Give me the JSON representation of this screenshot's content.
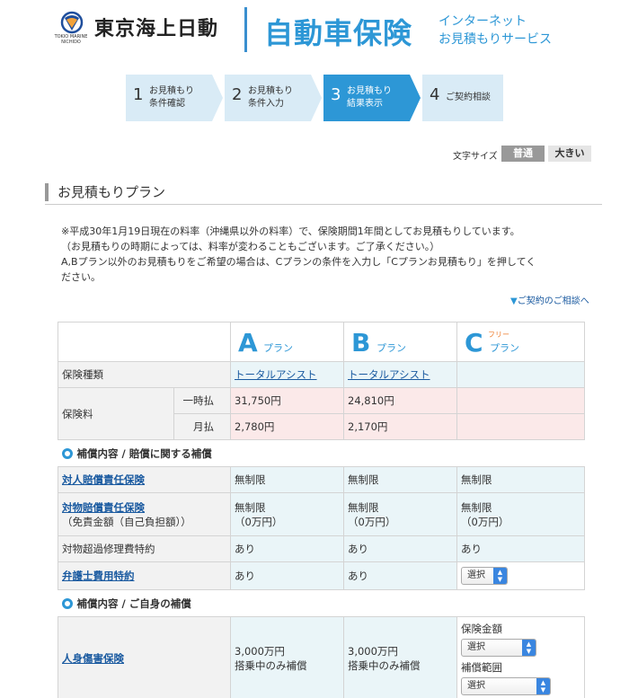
{
  "header": {
    "company_name": "東京海上日動",
    "company_sub": "TOKIO MARINE NICHIDO",
    "title": "自動車保険",
    "subtitle_line1": "インターネット",
    "subtitle_line2": "お見積もりサービス",
    "brand_color": "#2d97d6"
  },
  "steps": [
    {
      "num": "1",
      "line1": "お見積もり",
      "line2": "条件確認",
      "active": false
    },
    {
      "num": "2",
      "line1": "お見積もり",
      "line2": "条件入力",
      "active": false
    },
    {
      "num": "3",
      "line1": "お見積もり",
      "line2": "結果表示",
      "active": true
    },
    {
      "num": "4",
      "line1": "ご契約相談",
      "line2": "",
      "active": false
    }
  ],
  "font_size": {
    "label": "文字サイズ",
    "normal": "普通",
    "large": "大きい"
  },
  "section": {
    "title": "お見積もりプラン"
  },
  "notice": {
    "line1": "※平成30年1月19日現在の料率（沖縄県以外の料率）で、保険期間1年間としてお見積もりしています。",
    "line2": "（お見積もりの時期によっては、料率が変わることもございます。ご了承ください。）",
    "line3": "A,Bプラン以外のお見積もりをご希望の場合は、Cプランの条件を入力し「Cプランお見積もり」を押してく",
    "line4": "ださい。"
  },
  "consult_link": "ご契約のご相談へ",
  "plans": {
    "a_letter": "A",
    "a_suffix": "プラン",
    "b_letter": "B",
    "b_suffix": "プラン",
    "c_letter": "C",
    "c_suffix": "プラン",
    "c_free": "フリー"
  },
  "table": {
    "insurance_type_label": "保険種類",
    "insurance_type_a": "トータルアシスト",
    "insurance_type_b": "トータルアシスト",
    "premium_label": "保険料",
    "lump_label": "一時払",
    "monthly_label": "月払",
    "lump_a": "31,750円",
    "lump_b": "24,810円",
    "monthly_a": "2,780円",
    "monthly_b": "2,170円",
    "cat1": "補償内容 / 賠償に関する補償",
    "bodily_label": "対人賠償責任保険",
    "bodily_a": "無制限",
    "bodily_b": "無制限",
    "bodily_c": "無制限",
    "property_label": "対物賠償責任保険",
    "property_sub": "（免責金額（自己負担額））",
    "property_a1": "無制限",
    "property_a2": "（0万円）",
    "property_b1": "無制限",
    "property_b2": "（0万円）",
    "property_c1": "無制限",
    "property_c2": "（0万円）",
    "repair_label": "対物超過修理費特約",
    "repair_a": "あり",
    "repair_b": "あり",
    "repair_c": "あり",
    "lawyer_label": "弁護士費用特約",
    "lawyer_a": "あり",
    "lawyer_b": "あり",
    "lawyer_c_select": "選択",
    "cat2": "補償内容 / ご自身の補償",
    "personal_label": "人身傷害保険",
    "personal_a1": "3,000万円",
    "personal_a2": "搭乗中のみ補償",
    "personal_b1": "3,000万円",
    "personal_b2": "搭乗中のみ補償",
    "personal_c_amount_label": "保険金額",
    "personal_c_amount_select": "選択",
    "personal_c_range_label": "補償範囲",
    "personal_c_range_select": "選択"
  }
}
